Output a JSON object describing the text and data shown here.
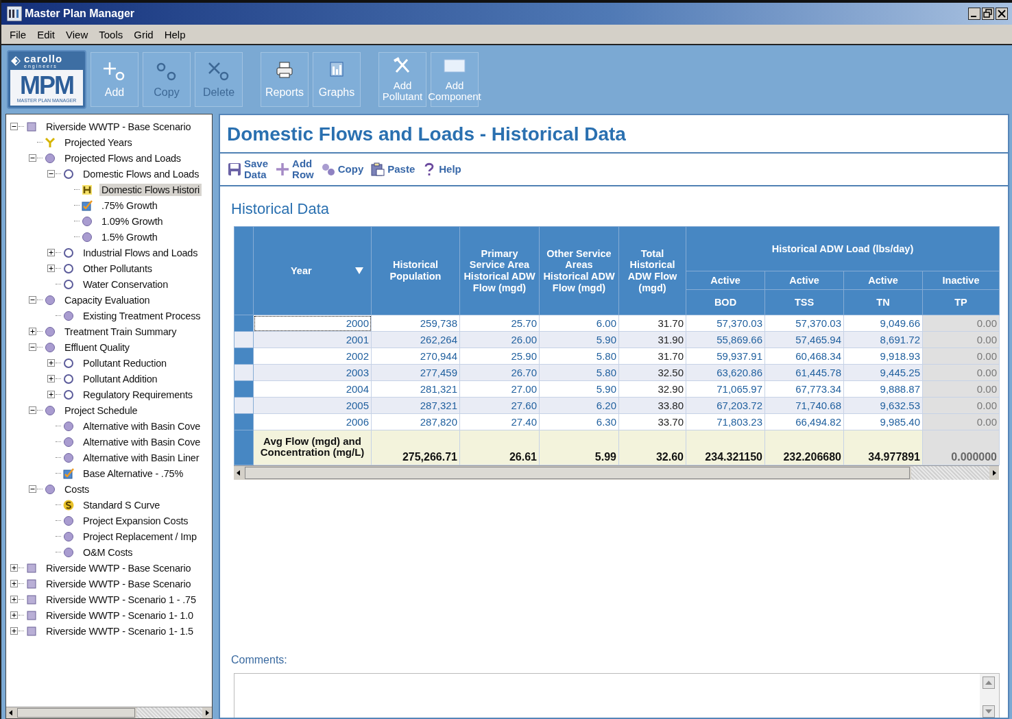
{
  "window": {
    "title": "Master Plan Manager"
  },
  "menu": [
    "File",
    "Edit",
    "View",
    "Tools",
    "Grid",
    "Help"
  ],
  "logo": {
    "brand": "carollo",
    "brand_sub": "engineers",
    "mark": "MPM",
    "caption": "MASTER PLAN MANAGER"
  },
  "toolbar": [
    {
      "label": "Add",
      "kind": "add",
      "disabled": false
    },
    {
      "label": "Copy",
      "kind": "copy",
      "disabled": true
    },
    {
      "label": "Delete",
      "kind": "delete",
      "disabled": true
    },
    {
      "label": "Reports",
      "kind": "reports",
      "disabled": false
    },
    {
      "label": "Graphs",
      "kind": "graphs",
      "disabled": false
    },
    {
      "label": "Add Pollutant",
      "kind": "tools",
      "disabled": false
    },
    {
      "label": "Add Component",
      "kind": "component",
      "disabled": false
    }
  ],
  "tree": [
    {
      "label": "Riverside WWTP - Base Scenario",
      "kind": "scenario",
      "expanded": true,
      "selected": false,
      "children": [
        {
          "label": "Projected Years",
          "kind": "years",
          "selected": false
        },
        {
          "label": "Projected Flows and Loads",
          "kind": "module",
          "expanded": true,
          "selected": false,
          "children": [
            {
              "label": "Domestic Flows and Loads",
              "kind": "group",
              "expanded": true,
              "selected": false,
              "children": [
                {
                  "label": "Domestic Flows Histori",
                  "kind": "history",
                  "selected": true
                },
                {
                  "label": ".75% Growth",
                  "kind": "base",
                  "selected": false
                },
                {
                  "label": "1.09% Growth",
                  "kind": "module",
                  "selected": false
                },
                {
                  "label": "1.5% Growth",
                  "kind": "module",
                  "selected": false
                }
              ]
            },
            {
              "label": "Industrial Flows and Loads",
              "kind": "group",
              "expanded": false,
              "selected": false
            },
            {
              "label": "Other Pollutants",
              "kind": "group",
              "expanded": false,
              "selected": false
            },
            {
              "label": "Water Conservation",
              "kind": "group",
              "selected": false
            }
          ]
        },
        {
          "label": "Capacity Evaluation",
          "kind": "module",
          "expanded": true,
          "selected": false,
          "children": [
            {
              "label": "Existing Treatment Process",
              "kind": "module",
              "selected": false
            }
          ]
        },
        {
          "label": "Treatment Train Summary",
          "kind": "module",
          "expanded": false,
          "selected": false
        },
        {
          "label": "Effluent Quality",
          "kind": "module",
          "expanded": true,
          "selected": false,
          "children": [
            {
              "label": "Pollutant Reduction",
              "kind": "group",
              "expanded": false,
              "selected": false
            },
            {
              "label": "Pollutant Addition",
              "kind": "group",
              "expanded": false,
              "selected": false
            },
            {
              "label": "Regulatory Requirements",
              "kind": "group",
              "expanded": false,
              "selected": false
            }
          ]
        },
        {
          "label": "Project Schedule",
          "kind": "module",
          "expanded": true,
          "selected": false,
          "children": [
            {
              "label": "Alternative with Basin Cove",
              "kind": "module",
              "selected": false
            },
            {
              "label": "Alternative with Basin Cove",
              "kind": "module",
              "selected": false
            },
            {
              "label": "Alternative with Basin Liner",
              "kind": "module",
              "selected": false
            },
            {
              "label": "Base Alternative - .75%",
              "kind": "base",
              "selected": false
            }
          ]
        },
        {
          "label": "Costs",
          "kind": "module",
          "expanded": true,
          "selected": false,
          "children": [
            {
              "label": "Standard S Curve",
              "kind": "curve",
              "selected": false
            },
            {
              "label": "Project Expansion Costs",
              "kind": "module",
              "selected": false
            },
            {
              "label": "Project Replacement / Imp",
              "kind": "module",
              "selected": false
            },
            {
              "label": "O&M Costs",
              "kind": "module",
              "selected": false
            }
          ]
        }
      ]
    },
    {
      "label": "Riverside WWTP - Base Scenario",
      "kind": "scenario",
      "expanded": false,
      "selected": false
    },
    {
      "label": "Riverside WWTP - Base Scenario",
      "kind": "scenario",
      "expanded": false,
      "selected": false
    },
    {
      "label": "Riverside WWTP - Scenario 1 - .75",
      "kind": "scenario",
      "expanded": false,
      "selected": false
    },
    {
      "label": "Riverside WWTP - Scenario 1- 1.0",
      "kind": "scenario",
      "expanded": false,
      "selected": false
    },
    {
      "label": "Riverside WWTP - Scenario 1- 1.5",
      "kind": "scenario",
      "expanded": false,
      "selected": false
    }
  ],
  "page": {
    "title": "Domestic Flows and Loads - Historical Data",
    "section": "Historical Data",
    "comments_label": "Comments:"
  },
  "actions": [
    {
      "label": "Save Data",
      "kind": "save"
    },
    {
      "label": "Add Row",
      "kind": "add"
    },
    {
      "label": "Copy",
      "kind": "copy"
    },
    {
      "label": "Paste",
      "kind": "paste"
    },
    {
      "label": "Help",
      "kind": "help"
    }
  ],
  "table": {
    "columns": [
      {
        "label": "Year",
        "editable": true
      },
      {
        "label": "Historical Population",
        "editable": true
      },
      {
        "label": "Primary Service Area Historical ADW Flow (mgd)",
        "editable": true
      },
      {
        "label": "Other Service Areas Historical ADW Flow (mgd)",
        "editable": true
      },
      {
        "label": "Total Historical ADW Flow (mgd)",
        "editable": false
      }
    ],
    "load_group": "Historical ADW Load (lbs/day)",
    "loads": [
      {
        "status": "Active",
        "name": "BOD",
        "enabled": true
      },
      {
        "status": "Active",
        "name": "TSS",
        "enabled": true
      },
      {
        "status": "Active",
        "name": "TN",
        "enabled": true
      },
      {
        "status": "Inactive",
        "name": "TP",
        "enabled": false
      }
    ],
    "rows": [
      {
        "selected": true,
        "cells": [
          "2000",
          "259,738",
          "25.70",
          "6.00",
          "31.70",
          "57,370.03",
          "57,370.03",
          "9,049.66",
          "0.00"
        ]
      },
      {
        "selected": false,
        "cells": [
          "2001",
          "262,264",
          "26.00",
          "5.90",
          "31.90",
          "55,869.66",
          "57,465.94",
          "8,691.72",
          "0.00"
        ]
      },
      {
        "selected": false,
        "cells": [
          "2002",
          "270,944",
          "25.90",
          "5.80",
          "31.70",
          "59,937.91",
          "60,468.34",
          "9,918.93",
          "0.00"
        ]
      },
      {
        "selected": false,
        "cells": [
          "2003",
          "277,459",
          "26.70",
          "5.80",
          "32.50",
          "63,620.86",
          "61,445.78",
          "9,445.25",
          "0.00"
        ]
      },
      {
        "selected": false,
        "cells": [
          "2004",
          "281,321",
          "27.00",
          "5.90",
          "32.90",
          "71,065.97",
          "67,773.34",
          "9,888.87",
          "0.00"
        ]
      },
      {
        "selected": false,
        "cells": [
          "2005",
          "287,321",
          "27.60",
          "6.20",
          "33.80",
          "67,203.72",
          "71,740.68",
          "9,632.53",
          "0.00"
        ]
      },
      {
        "selected": false,
        "cells": [
          "2006",
          "287,820",
          "27.40",
          "6.30",
          "33.70",
          "71,803.23",
          "66,494.82",
          "9,985.40",
          "0.00"
        ]
      }
    ],
    "footer": [
      "Avg Flow (mgd) and Concentration (mg/L)",
      "275,266.71",
      "26.61",
      "5.99",
      "32.60",
      "234.321150",
      "232.206680",
      "34.977891",
      "0.000000"
    ]
  }
}
